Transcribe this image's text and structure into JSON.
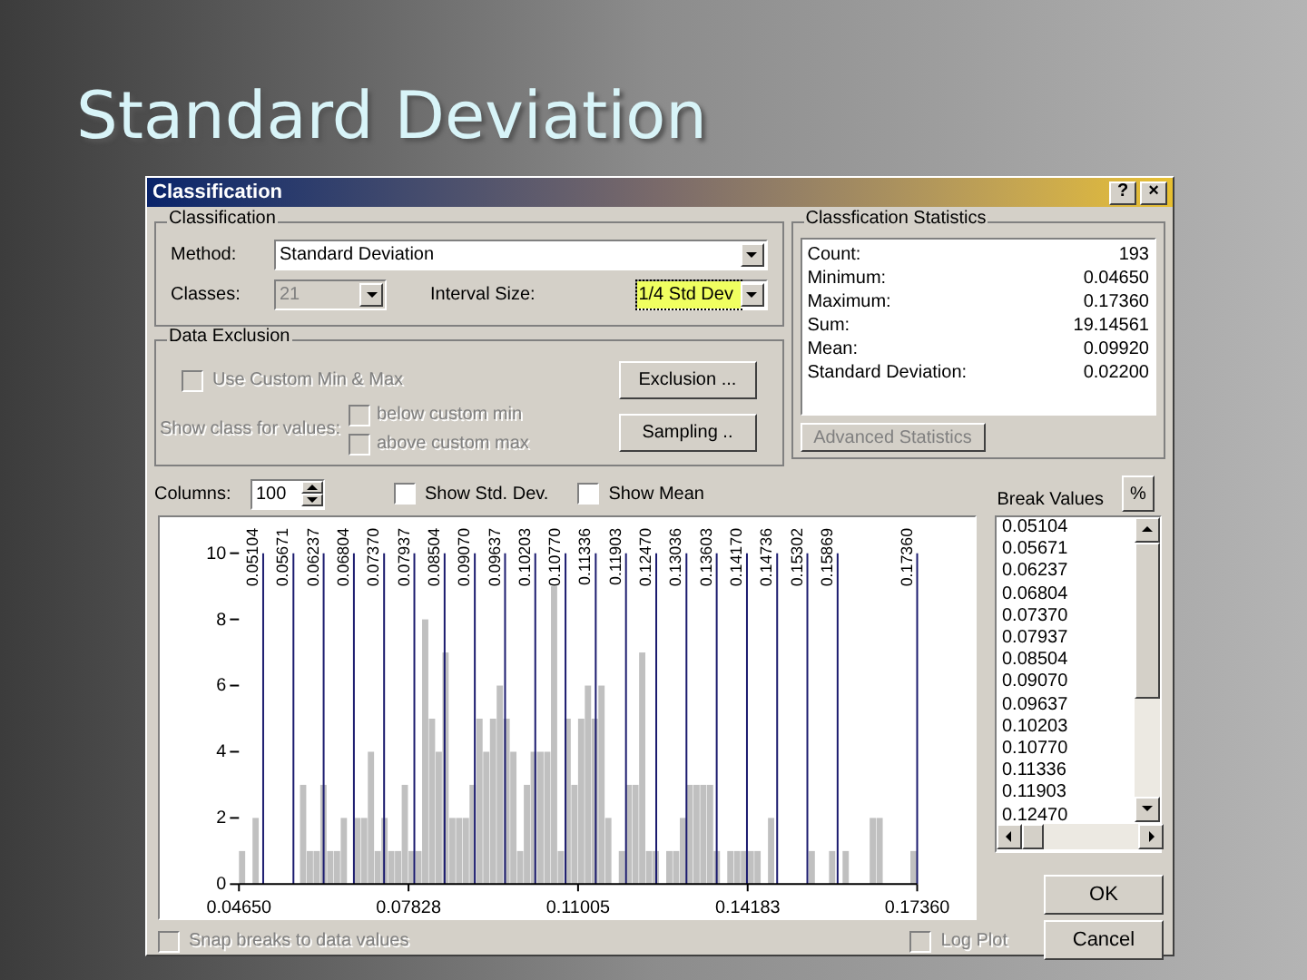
{
  "slide": {
    "title": "Standard Deviation"
  },
  "window": {
    "title": "Classification",
    "buttons": [
      "?",
      "×"
    ]
  },
  "classification": {
    "legend": "Classification",
    "method_label": "Method:",
    "method": "Standard Deviation",
    "classes_label": "Classes:",
    "classes": "21",
    "classes_disabled": true,
    "interval_label": "Interval Size:",
    "interval": "1/4 Std Dev",
    "interval_focused": true
  },
  "data_exclusion": {
    "legend": "Data Exclusion",
    "custom_minmax": {
      "label": "Use Custom Min & Max",
      "checked": false,
      "disabled": true
    },
    "show_class_label": "Show class for values:",
    "show_class_options": [
      {
        "label": "below custom min",
        "checked": false,
        "disabled": true
      },
      {
        "label": "above custom max",
        "checked": false,
        "disabled": true
      }
    ],
    "buttons": [
      "Exclusion ...",
      "Sampling .."
    ]
  },
  "statistics": {
    "legend": "Classfication Statistics",
    "rows": [
      {
        "label": "Count:",
        "value": "193"
      },
      {
        "label": "Minimum:",
        "value": "0.04650"
      },
      {
        "label": "Maximum:",
        "value": "0.17360"
      },
      {
        "label": "Sum:",
        "value": "19.14561"
      },
      {
        "label": "Mean:",
        "value": "0.09920"
      },
      {
        "label": "Standard Deviation:",
        "value": "0.02200"
      }
    ],
    "button": {
      "label": "Advanced Statistics",
      "disabled": true
    }
  },
  "columns": {
    "label": "Columns:",
    "value": "100"
  },
  "options": [
    {
      "label": "Show Std. Dev.",
      "checked": false
    },
    {
      "label": "Show Mean",
      "checked": false
    }
  ],
  "histogram": {
    "chart_data": {
      "type": "bar",
      "xlim": [
        0.0465,
        0.1736
      ],
      "ylim": [
        0,
        10
      ],
      "xticks": [
        {
          "value": 0.0465,
          "label": "0.04650"
        },
        {
          "value": 0.07828,
          "label": "0.07828"
        },
        {
          "value": 0.11005,
          "label": "0.11005"
        },
        {
          "value": 0.14183,
          "label": "0.14183"
        },
        {
          "value": 0.1736,
          "label": "0.17360"
        }
      ],
      "yticks": [
        {
          "value": 0,
          "label": "0"
        },
        {
          "value": 2,
          "label": "2"
        },
        {
          "value": 4,
          "label": "4"
        },
        {
          "value": 6,
          "label": "6"
        },
        {
          "value": 8,
          "label": "8"
        },
        {
          "value": 10,
          "label": "10"
        }
      ],
      "x": [
        0.0465,
        0.04777,
        0.04904,
        0.05031,
        0.05158,
        0.05286,
        0.05413,
        0.0554,
        0.05667,
        0.05794,
        0.05921,
        0.06048,
        0.06175,
        0.06302,
        0.06429,
        0.06557,
        0.06684,
        0.06811,
        0.06938,
        0.07065,
        0.07192,
        0.07319,
        0.07446,
        0.07573,
        0.077,
        0.07828,
        0.07955,
        0.08082,
        0.08209,
        0.08336,
        0.08463,
        0.0859,
        0.08717,
        0.08844,
        0.08971,
        0.09099,
        0.09226,
        0.09353,
        0.0948,
        0.09607,
        0.09734,
        0.09861,
        0.09988,
        0.10115,
        0.10242,
        0.1037,
        0.10497,
        0.10624,
        0.10751,
        0.10878,
        0.11005,
        0.11132,
        0.11259,
        0.11386,
        0.11513,
        0.11641,
        0.11768,
        0.11895,
        0.12022,
        0.12149,
        0.12276,
        0.12403,
        0.1253,
        0.12657,
        0.12784,
        0.12912,
        0.13039,
        0.13166,
        0.13293,
        0.1342,
        0.13547,
        0.13674,
        0.13801,
        0.13928,
        0.14055,
        0.14183,
        0.1431,
        0.14437,
        0.14564,
        0.14691,
        0.14818,
        0.14945,
        0.15072,
        0.15199,
        0.15326,
        0.15454,
        0.15581,
        0.15708,
        0.15835,
        0.15962,
        0.16089,
        0.16216,
        0.16343,
        0.1647,
        0.16597,
        0.16725,
        0.16852,
        0.16979,
        0.17106,
        0.17233
      ],
      "values": [
        1,
        0,
        2,
        0,
        0,
        0,
        0,
        0,
        0,
        3,
        1,
        1,
        3,
        1,
        1,
        2,
        0,
        2,
        2,
        4,
        1,
        2,
        1,
        1,
        3,
        1,
        1,
        8,
        5,
        4,
        7,
        2,
        2,
        2,
        3,
        5,
        4,
        5,
        6,
        5,
        4,
        1,
        3,
        4,
        4,
        4,
        9,
        1,
        5,
        3,
        5,
        6,
        5,
        6,
        2,
        0,
        1,
        3,
        3,
        7,
        1,
        1,
        0,
        1,
        1,
        2,
        3,
        3,
        3,
        3,
        1,
        0,
        1,
        1,
        1,
        1,
        1,
        0,
        2,
        0,
        0,
        0,
        0,
        0,
        1,
        0,
        0,
        1,
        0,
        1,
        0,
        0,
        0,
        2,
        2,
        0,
        0,
        0,
        0,
        1
      ],
      "grid": false,
      "ref_lines": [
        {
          "axis": "x",
          "value": 0.05104,
          "label": "0.05104"
        },
        {
          "axis": "x",
          "value": 0.05671,
          "label": "0.05671"
        },
        {
          "axis": "x",
          "value": 0.06237,
          "label": "0.06237"
        },
        {
          "axis": "x",
          "value": 0.06804,
          "label": "0.06804"
        },
        {
          "axis": "x",
          "value": 0.0737,
          "label": "0.07370"
        },
        {
          "axis": "x",
          "value": 0.07937,
          "label": "0.07937"
        },
        {
          "axis": "x",
          "value": 0.08504,
          "label": "0.08504"
        },
        {
          "axis": "x",
          "value": 0.0907,
          "label": "0.09070"
        },
        {
          "axis": "x",
          "value": 0.09637,
          "label": "0.09637"
        },
        {
          "axis": "x",
          "value": 0.10203,
          "label": "0.10203"
        },
        {
          "axis": "x",
          "value": 0.1077,
          "label": "0.10770"
        },
        {
          "axis": "x",
          "value": 0.11336,
          "label": "0.11336"
        },
        {
          "axis": "x",
          "value": 0.11903,
          "label": "0.11903"
        },
        {
          "axis": "x",
          "value": 0.1247,
          "label": "0.12470"
        },
        {
          "axis": "x",
          "value": 0.13036,
          "label": "0.13036"
        },
        {
          "axis": "x",
          "value": 0.13603,
          "label": "0.13603"
        },
        {
          "axis": "x",
          "value": 0.1417,
          "label": "0.14170"
        },
        {
          "axis": "x",
          "value": 0.14736,
          "label": "0.14736"
        },
        {
          "axis": "x",
          "value": 0.15302,
          "label": "0.15302"
        },
        {
          "axis": "x",
          "value": 0.15869,
          "label": "0.15869"
        },
        {
          "axis": "x",
          "value": 0.1736,
          "label": "0.17360"
        }
      ]
    }
  },
  "break_values": {
    "label": "Break Values",
    "percent_button": "%",
    "items": [
      "0.05104",
      "0.05671",
      "0.06237",
      "0.06804",
      "0.07370",
      "0.07937",
      "0.08504",
      "0.09070",
      "0.09637",
      "0.10203",
      "0.10770",
      "0.11336",
      "0.11903",
      "0.12470"
    ]
  },
  "footer_options": [
    {
      "label": "Snap breaks to data values",
      "checked": false,
      "disabled": true
    },
    {
      "label": "Log Plot",
      "checked": false,
      "disabled": true
    }
  ],
  "dialog_buttons": [
    "OK",
    "Cancel"
  ]
}
